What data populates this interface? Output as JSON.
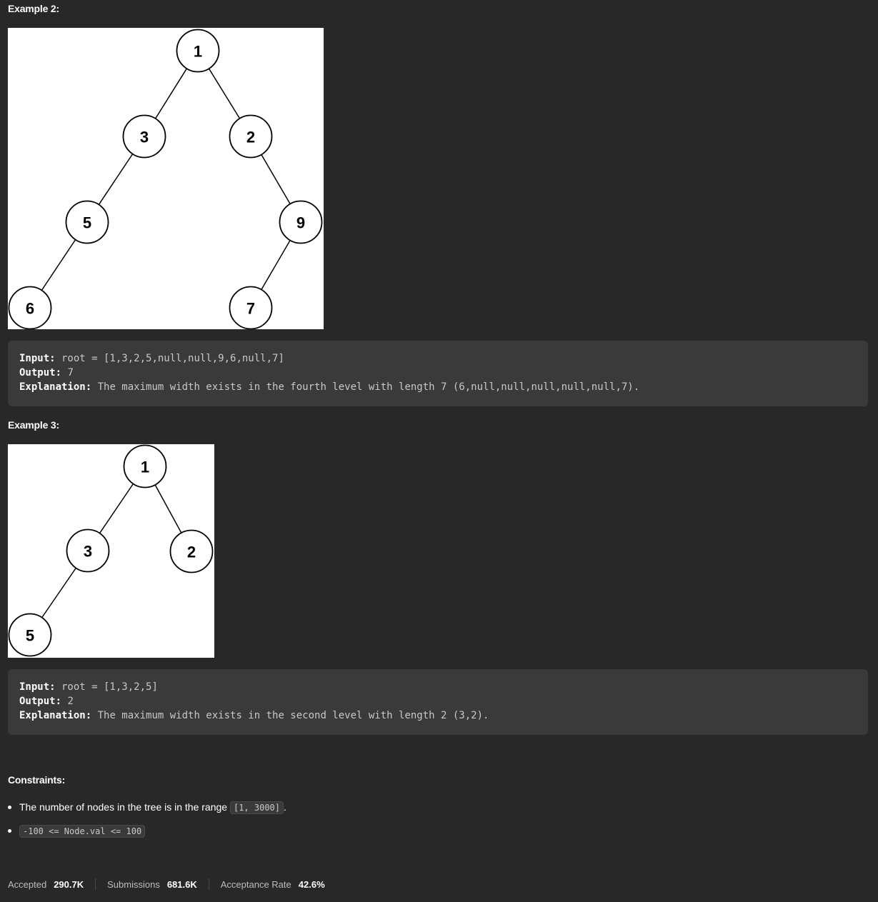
{
  "example2": {
    "title": "Example 2:",
    "tree_nodes": [
      "1",
      "3",
      "2",
      "5",
      "9",
      "6",
      "7"
    ],
    "input_label": "Input:",
    "input_value": " root = [1,3,2,5,null,null,9,6,null,7]",
    "output_label": "Output:",
    "output_value": " 7",
    "explanation_label": "Explanation:",
    "explanation_value": " The maximum width exists in the fourth level with length 7 (6,null,null,null,null,null,7)."
  },
  "example3": {
    "title": "Example 3:",
    "tree_nodes": [
      "1",
      "3",
      "2",
      "5"
    ],
    "input_label": "Input:",
    "input_value": " root = [1,3,2,5]",
    "output_label": "Output:",
    "output_value": " 2",
    "explanation_label": "Explanation:",
    "explanation_value": " The maximum width exists in the second level with length 2 (3,2)."
  },
  "constraints": {
    "title": "Constraints:",
    "items": [
      {
        "text": "The number of nodes in the tree is in the range ",
        "code": "[1, 3000]",
        "suffix": "."
      },
      {
        "text": "",
        "code": "-100 <= Node.val <= 100",
        "suffix": ""
      }
    ]
  },
  "stats": {
    "accepted_label": "Accepted",
    "accepted_value": "290.7K",
    "submissions_label": "Submissions",
    "submissions_value": "681.6K",
    "rate_label": "Acceptance Rate",
    "rate_value": "42.6%"
  }
}
